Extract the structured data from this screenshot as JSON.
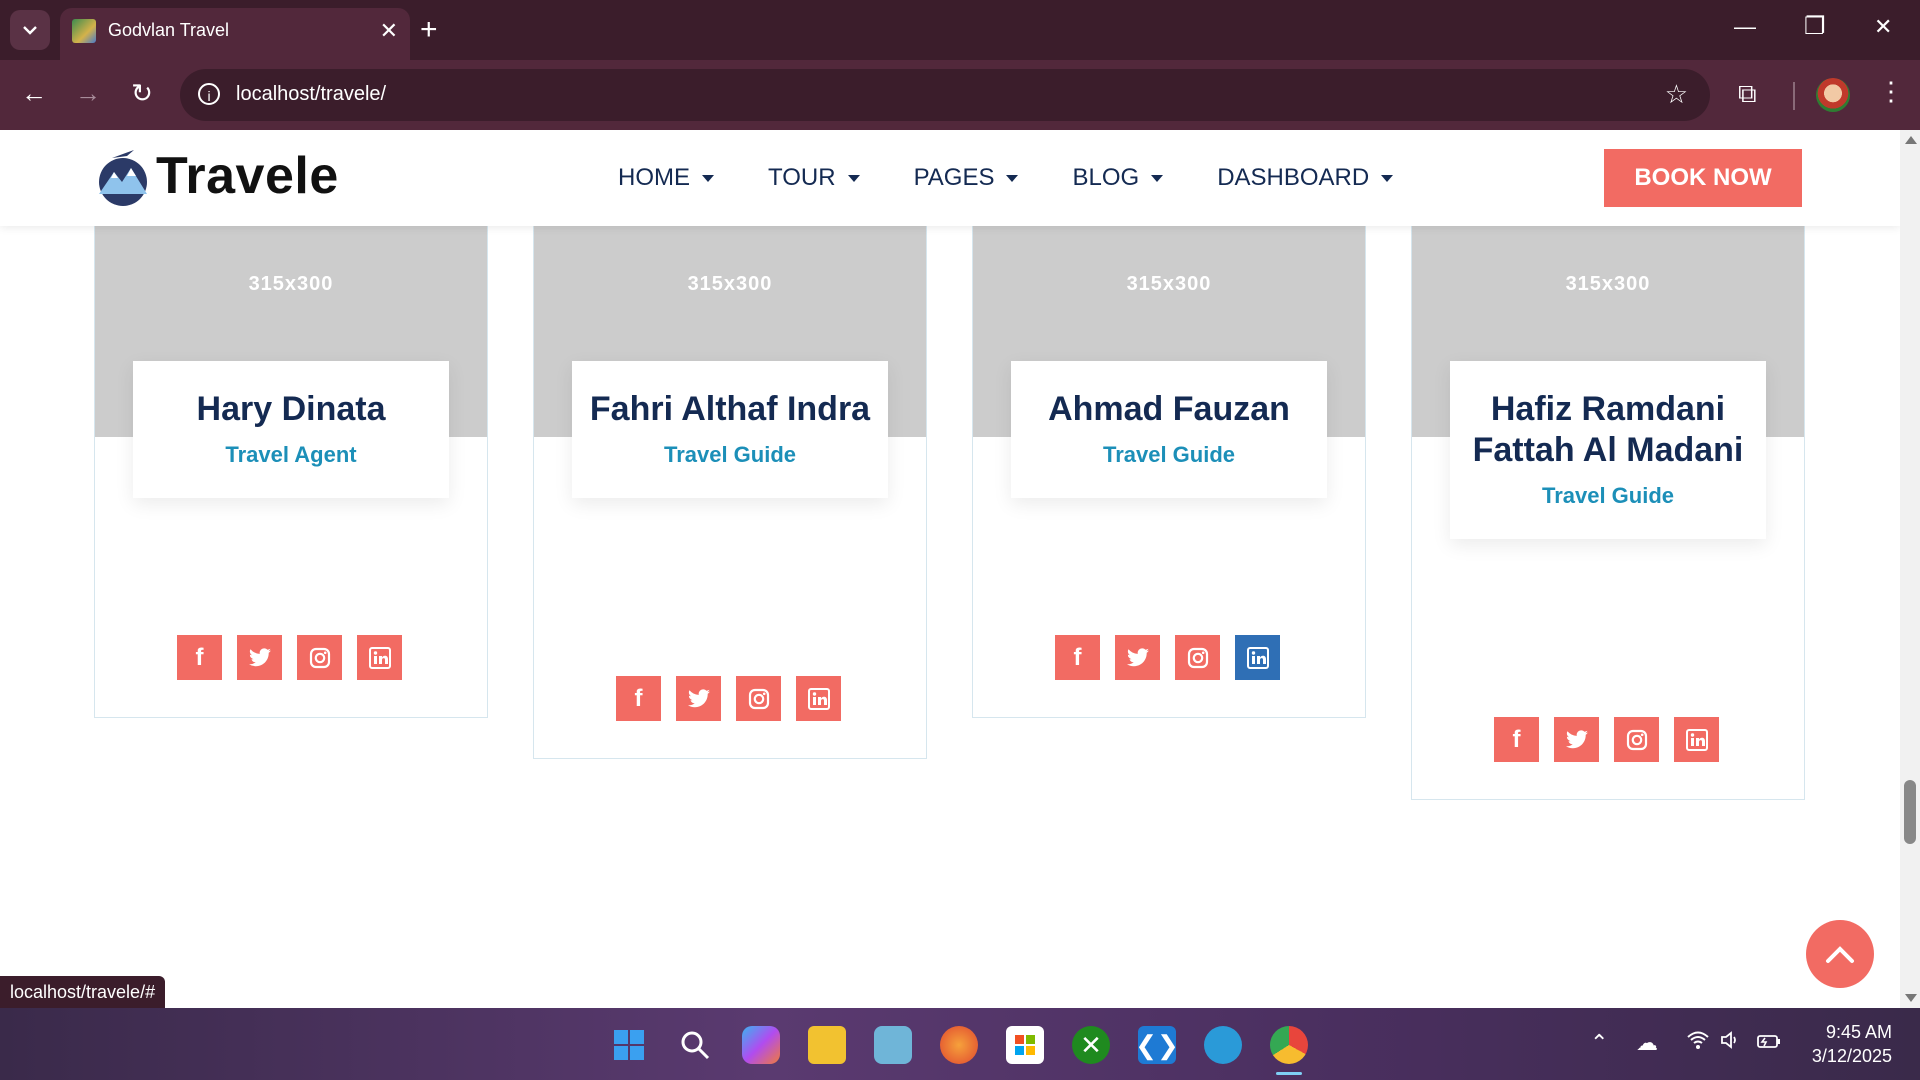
{
  "browser": {
    "tab_title": "Godvlan Travel",
    "url": "localhost/travele/",
    "status_url": "localhost/travele/#"
  },
  "site": {
    "logo_text": "Travele",
    "nav": [
      "HOME",
      "TOUR",
      "PAGES",
      "BLOG",
      "DASHBOARD"
    ],
    "book_label": "BOOK NOW",
    "accent": "#f26b63",
    "navy": "#142a52",
    "role_color": "#1c8fb8"
  },
  "team": [
    {
      "image_label": "315x300",
      "name": "Hary Dinata",
      "role": "Travel Agent"
    },
    {
      "image_label": "315x300",
      "name": "Fahri Althaf Indra",
      "role": "Travel Guide"
    },
    {
      "image_label": "315x300",
      "name": "Ahmad Fauzan",
      "role": "Travel Guide"
    },
    {
      "image_label": "315x300",
      "name": "Hafiz Ramdani Fattah Al Madani",
      "role": "Travel Guide"
    }
  ],
  "taskbar": {
    "time": "9:45 AM",
    "date": "3/12/2025"
  }
}
